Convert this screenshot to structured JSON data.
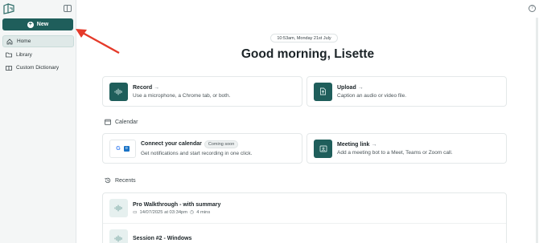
{
  "sidebar": {
    "new_label": "New",
    "items": [
      {
        "label": "Home",
        "icon": "home-icon",
        "active": true
      },
      {
        "label": "Library",
        "icon": "folder-icon",
        "active": false
      },
      {
        "label": "Custom Dictionary",
        "icon": "book-icon",
        "active": false
      }
    ]
  },
  "header": {
    "date_text": "10:53am, Monday 21st July",
    "greeting": "Good morning, Lisette"
  },
  "cards": {
    "record": {
      "title": "Record",
      "desc": "Use a microphone, a Chrome tab, or both."
    },
    "upload": {
      "title": "Upload",
      "desc": "Caption an audio or video file."
    }
  },
  "calendar": {
    "section_label": "Calendar",
    "connect_title": "Connect your calendar",
    "connect_badge": "Coming soon",
    "connect_desc": "Get notifications and start recording in one click.",
    "meeting_title": "Meeting link",
    "meeting_desc": "Add a meeting bot to a Meet, Teams or Zoom call."
  },
  "recents": {
    "section_label": "Recents",
    "items": [
      {
        "name": "Pro Walkthrough - with summary",
        "date": "14/07/2025 at 03:34pm",
        "duration": "4 mins"
      },
      {
        "name": "Session #2 - Windows",
        "date": "",
        "duration": ""
      }
    ]
  },
  "colors": {
    "accent": "#1f5e5b",
    "annotation_arrow": "#e53a2a"
  }
}
